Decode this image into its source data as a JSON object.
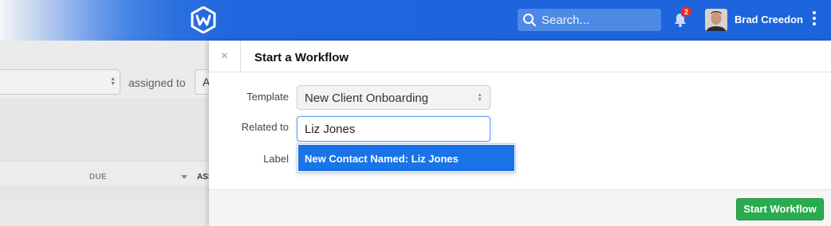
{
  "header": {
    "search_placeholder": "Search...",
    "notification_count": "2",
    "user_name": "Brad Creedon"
  },
  "background": {
    "assigned_label": "assigned to",
    "assigned_value": "A",
    "col_due": "DUE",
    "col_assigned": "ASS"
  },
  "panel": {
    "close_label": "×",
    "title": "Start a Workflow",
    "template_label": "Template",
    "template_value": "New Client Onboarding",
    "related_label": "Related to",
    "related_value": "Liz Jones",
    "label_label": "Label",
    "suggestion": "New Contact Named: Liz Jones",
    "start_button": "Start Workflow"
  },
  "colors": {
    "header_blue": "#1c64dc",
    "highlight_blue": "#1a73e8",
    "start_green": "#2bab4f",
    "badge_red": "#e52d2d"
  },
  "icons": [
    "logo-icon",
    "search-icon",
    "bell-icon",
    "kebab-menu-icon",
    "select-arrows-icon",
    "close-icon"
  ]
}
